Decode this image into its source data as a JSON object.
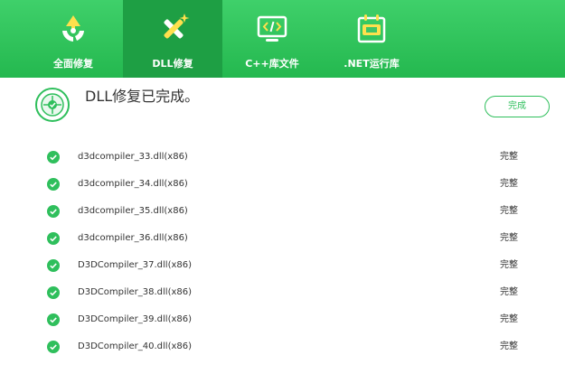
{
  "tabs": [
    {
      "label": "全面修复",
      "icon": "recycle-icon",
      "active": false
    },
    {
      "label": "DLL修复",
      "icon": "tools-icon",
      "active": true
    },
    {
      "label": "C++库文件",
      "icon": "code-monitor-icon",
      "active": false
    },
    {
      "label": ".NET运行库",
      "icon": "net-calendar-icon",
      "active": false
    }
  ],
  "status": {
    "title": "DLL修复已完成。",
    "done_button": "完成"
  },
  "colors": {
    "brand_green": "#24b84f",
    "active_tab": "#1e9f44",
    "check_green": "#2fbf5c"
  },
  "files": [
    {
      "name": "d3dcompiler_33.dll(x86)",
      "status": "完整"
    },
    {
      "name": "d3dcompiler_34.dll(x86)",
      "status": "完整"
    },
    {
      "name": "d3dcompiler_35.dll(x86)",
      "status": "完整"
    },
    {
      "name": "d3dcompiler_36.dll(x86)",
      "status": "完整"
    },
    {
      "name": "D3DCompiler_37.dll(x86)",
      "status": "完整"
    },
    {
      "name": "D3DCompiler_38.dll(x86)",
      "status": "完整"
    },
    {
      "name": "D3DCompiler_39.dll(x86)",
      "status": "完整"
    },
    {
      "name": "D3DCompiler_40.dll(x86)",
      "status": "完整"
    }
  ]
}
